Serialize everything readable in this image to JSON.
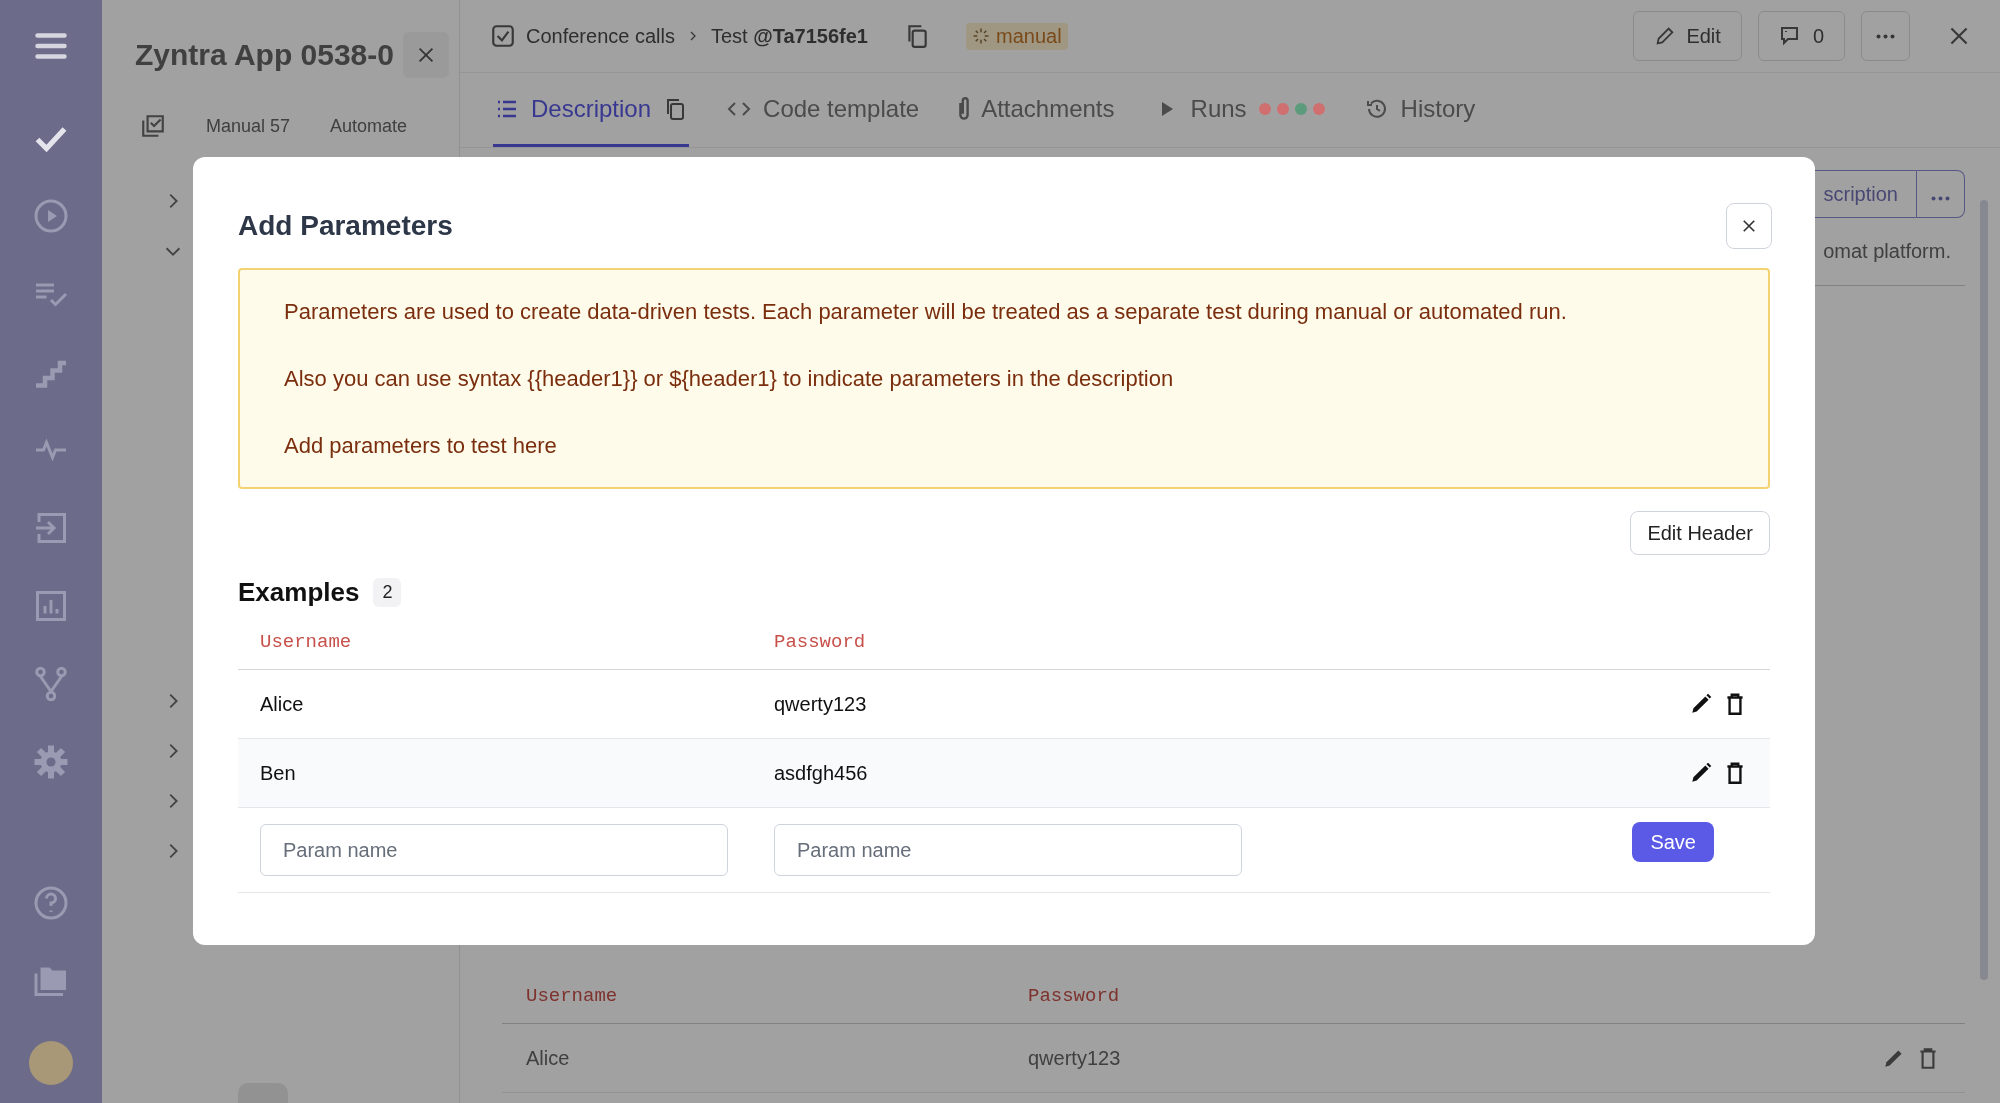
{
  "left_panel": {
    "title": "Zyntra App 0538-0",
    "tabs": [
      "Manual 57",
      "Automate"
    ],
    "tree_rows": [
      {
        "expanded": false
      },
      {
        "expanded": true
      },
      {
        "expanded": false
      },
      {
        "expanded": false
      },
      {
        "expanded": false
      },
      {
        "expanded": false
      }
    ]
  },
  "header": {
    "breadcrumb": "Conference calls",
    "test": "Test **@Ta7156fe1**",
    "badge": "manual",
    "edit": "Edit",
    "comments": "0"
  },
  "tabs": [
    {
      "label": "Description",
      "selected": true,
      "kind": "list"
    },
    {
      "label": "Code template",
      "selected": false,
      "kind": "code"
    },
    {
      "label": "Attachments",
      "selected": false,
      "kind": "clip"
    },
    {
      "label": "Runs",
      "selected": false,
      "kind": "runs",
      "dots": [
        {
          "color": "#cf6f6f"
        },
        {
          "color": "#cf6f6f"
        },
        {
          "color": "#5c9c7c"
        },
        {
          "color": "#cf6f6f"
        }
      ]
    },
    {
      "label": "History",
      "selected": false,
      "kind": "history"
    }
  ],
  "background": {
    "button": "scription",
    "text": "omat platform.",
    "columns": [
      "Username",
      "Password"
    ],
    "rows": [
      [
        "Alice",
        "qwerty123"
      ]
    ]
  },
  "modal": {
    "title": "Add Parameters",
    "notice": [
      "Parameters are used to create data-driven tests. Each parameter will be treated as a separate test during manual or automated run.",
      "Also you can use syntax {{header1}} or ${header1} to indicate parameters in the description",
      "Add parameters to test here"
    ],
    "edit_header": "Edit Header",
    "examples_title": "Examples",
    "examples_count": "2",
    "columns": [
      "Username",
      "Password"
    ],
    "rows": [
      [
        "Alice",
        "qwerty123"
      ],
      [
        "Ben",
        "asdfgh456"
      ]
    ],
    "inputs": [
      {
        "placeholder": "Param name"
      },
      {
        "placeholder": "Param name"
      }
    ],
    "save": "Save"
  }
}
